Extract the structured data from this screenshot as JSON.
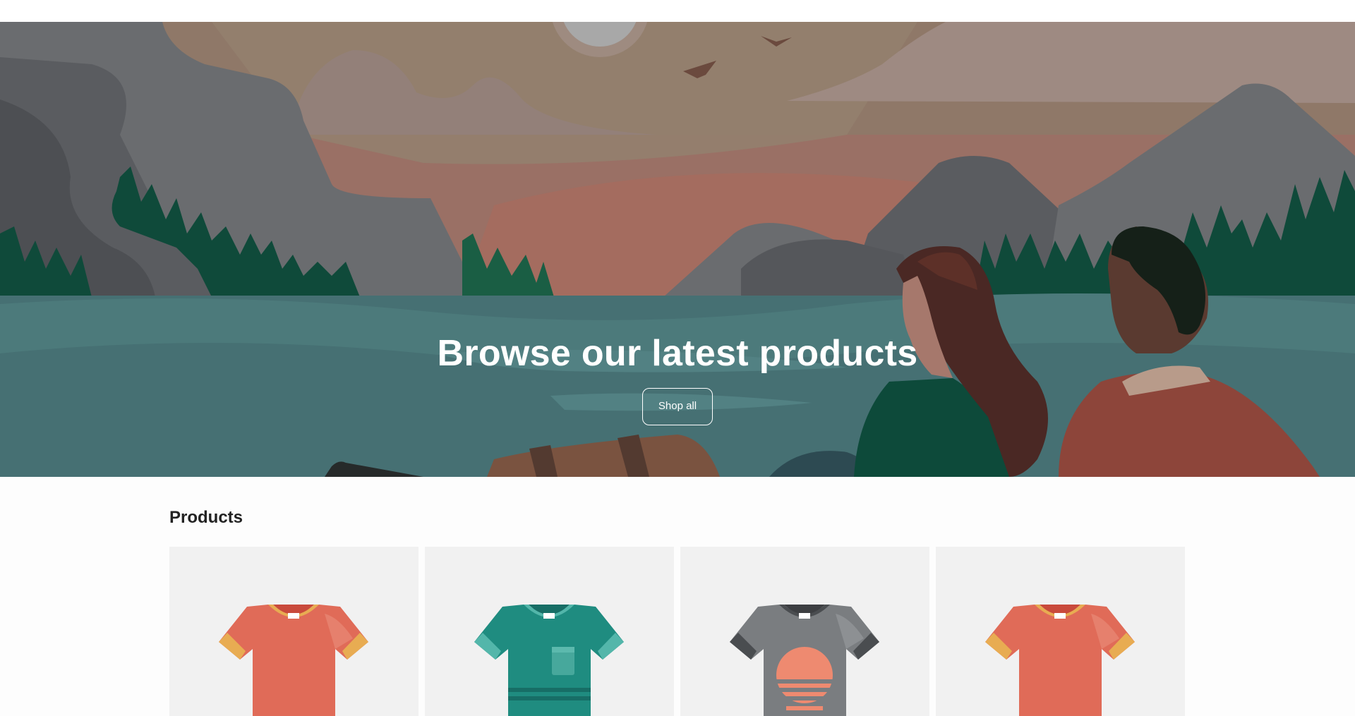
{
  "hero": {
    "title": "Browse our latest products",
    "cta_label": "Shop all"
  },
  "products": {
    "heading": "Products",
    "items": [
      {
        "icon": "tshirt-coral-icon",
        "colors": {
          "body": "#e06b58",
          "trim": "#e8ac52",
          "collar_inner": "#c94a3c"
        }
      },
      {
        "icon": "tshirt-teal-pocket-icon",
        "colors": {
          "body": "#1f8c80",
          "trim": "#53b6aa",
          "collar_inner": "#176e66"
        }
      },
      {
        "icon": "tshirt-gray-sunset-icon",
        "colors": {
          "body": "#7a7d80",
          "trim": "#4a4d50",
          "collar_inner": "#3d3f42",
          "graphic": "#ee8a70"
        }
      },
      {
        "icon": "tshirt-coral-icon",
        "colors": {
          "body": "#e06b58",
          "trim": "#e8ac52",
          "collar_inner": "#c94a3c"
        }
      }
    ]
  }
}
